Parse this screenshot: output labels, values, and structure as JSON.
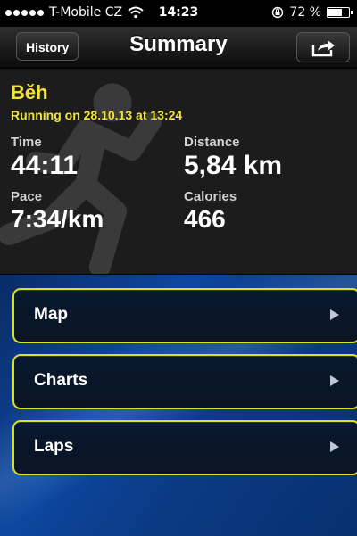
{
  "status_bar": {
    "carrier": "T-Mobile CZ",
    "time": "14:23",
    "battery_label": "72 %",
    "battery_level": 0.72
  },
  "nav": {
    "back_label": "History",
    "title": "Summary",
    "share_icon": "share-icon"
  },
  "summary": {
    "activity_name": "Běh",
    "subtitle": "Running on 28.10.13 at 13:24",
    "stats": {
      "time_label": "Time",
      "time_value": "44:11",
      "distance_label": "Distance",
      "distance_value": "5,84 km",
      "pace_label": "Pace",
      "pace_value": "7:34/km",
      "calories_label": "Calories",
      "calories_value": "466"
    },
    "accent_color": "#f2e537",
    "background_icon": "runner-icon"
  },
  "menu": {
    "items": [
      {
        "label": "Map"
      },
      {
        "label": "Charts"
      },
      {
        "label": "Laps"
      }
    ],
    "border_color": "#d9e21e",
    "chevron_icon": "chevron-right-icon"
  }
}
